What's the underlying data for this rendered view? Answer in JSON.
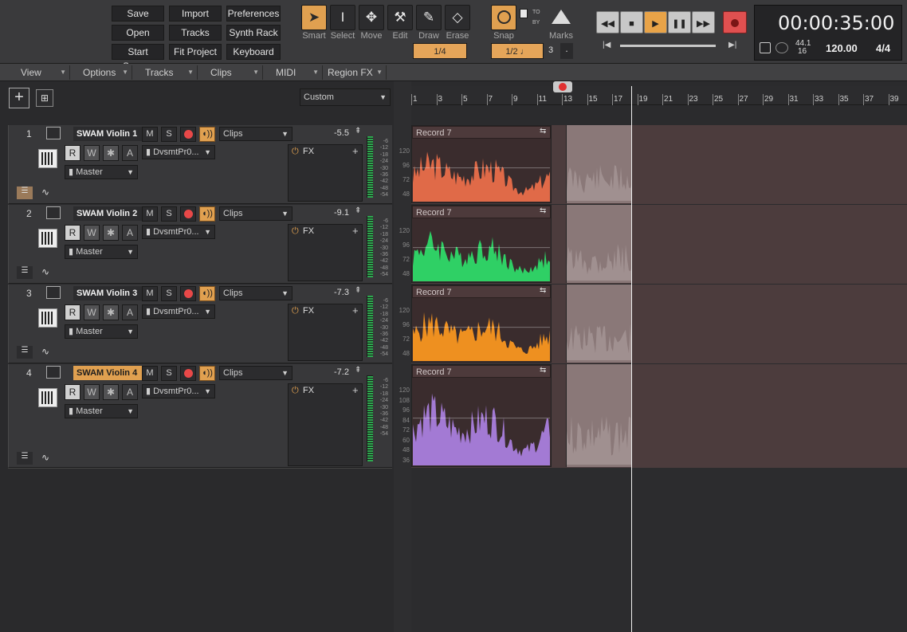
{
  "toolbar": {
    "file_buttons": [
      "Save",
      "Import",
      "Preferences",
      "Open",
      "Tracks",
      "Synth Rack",
      "Start Screen",
      "Fit Project",
      "Keyboard"
    ],
    "tools": [
      {
        "label": "Smart",
        "icon": "arrow-pointer-icon"
      },
      {
        "label": "Select",
        "icon": "text-cursor-icon"
      },
      {
        "label": "Move",
        "icon": "move-arrows-icon"
      },
      {
        "label": "Edit",
        "icon": "wrench-icon"
      },
      {
        "label": "Draw",
        "icon": "pencil-icon"
      },
      {
        "label": "Erase",
        "icon": "eraser-icon"
      }
    ],
    "snap_label": "Snap",
    "snap_to": "TO",
    "snap_by": "BY",
    "marks_label": "Marks",
    "tool_resolution": "1/4",
    "snap_resolution": "1/2",
    "snap_count": "3",
    "snap_dot": ".",
    "time": "00:00:35:00",
    "sample_rate": "44.1",
    "bit_depth": "16",
    "tempo": "120.00",
    "meter": "4/4",
    "transport": [
      {
        "icon": "rewind-icon",
        "glyph": "◀◀"
      },
      {
        "icon": "stop-icon",
        "glyph": "■"
      },
      {
        "icon": "play-icon",
        "glyph": "▶"
      },
      {
        "icon": "pause-icon",
        "glyph": "❚❚"
      },
      {
        "icon": "fast-forward-icon",
        "glyph": "▶▶"
      }
    ]
  },
  "menus": [
    "View",
    "Options",
    "Tracks",
    "Clips",
    "MIDI",
    "Region FX"
  ],
  "track_header": {
    "preset": "Custom"
  },
  "ruler_ticks": [
    "1",
    "3",
    "5",
    "7",
    "9",
    "11",
    "13",
    "15",
    "17",
    "19",
    "21",
    "23",
    "25",
    "27",
    "29",
    "31",
    "33",
    "35",
    "37",
    "39"
  ],
  "tracks": [
    {
      "num": "1",
      "name": "SWAM Violin 1",
      "view": "Clips",
      "volume": "-5.5",
      "input": "DvsmtPr0...",
      "output": "Master",
      "fx": "FX",
      "clip": "Record 7",
      "color": "#e06a48",
      "selected": false
    },
    {
      "num": "2",
      "name": "SWAM Violin 2",
      "view": "Clips",
      "volume": "-9.1",
      "input": "DvsmtPr0...",
      "output": "Master",
      "fx": "FX",
      "clip": "Record 7",
      "color": "#2fd065",
      "selected": false
    },
    {
      "num": "3",
      "name": "SWAM Violin 3",
      "view": "Clips",
      "volume": "-7.3",
      "input": "DvsmtPr0...",
      "output": "Master",
      "fx": "FX",
      "clip": "Record 7",
      "color": "#ee9020",
      "selected": false
    },
    {
      "num": "4",
      "name": "SWAM Violin 4",
      "view": "Clips",
      "volume": "-7.2",
      "input": "DvsmtPr0...",
      "output": "Master",
      "fx": "FX",
      "clip": "Record 7",
      "color": "#a37ad4",
      "selected": true
    }
  ],
  "track_buttons": {
    "mute": "M",
    "solo": "S",
    "read": "R",
    "write": "W",
    "freeze": "✱",
    "arm": "A"
  },
  "meter_scale": [
    "-6",
    "-12",
    "-18",
    "-24",
    "-30",
    "-36",
    "-42",
    "-48",
    "-54"
  ],
  "clip_scale": [
    "120",
    "96",
    "72",
    "48"
  ],
  "clip_scale_4": [
    "120",
    "108",
    "96",
    "84",
    "72",
    "60",
    "48",
    "36"
  ]
}
